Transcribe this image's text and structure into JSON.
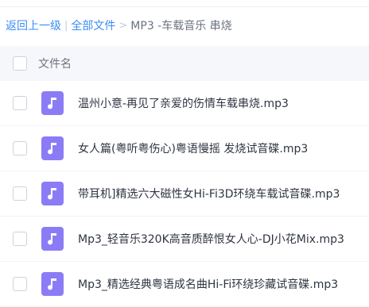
{
  "breadcrumb": {
    "back_label": "返回上一级",
    "separator": "|",
    "all_files_label": "全部文件",
    "chevron": ">",
    "current_label": "MP3 -车载音乐 串烧"
  },
  "list_header": {
    "column_name": "文件名"
  },
  "icons": {
    "file_type": "music-note-icon",
    "accent_color": "#8b7cf6",
    "link_color": "#3b8cf5"
  },
  "files": [
    {
      "name": "温州小意-再见了亲爱的伤情车载串烧.mp3"
    },
    {
      "name": "女人篇(粤听粤伤心)粤语慢摇 发烧试音碟.mp3"
    },
    {
      "name": "带耳机]精选六大磁性女Hi-Fi3D环绕车载试音碟.mp3"
    },
    {
      "name": "Mp3_轻音乐320K高音质醉恨女人心-DJ小花Mix.mp3"
    },
    {
      "name": "Mp3_精选经典粤语成名曲Hi-Fi环绕珍藏试音碟.mp3"
    }
  ]
}
